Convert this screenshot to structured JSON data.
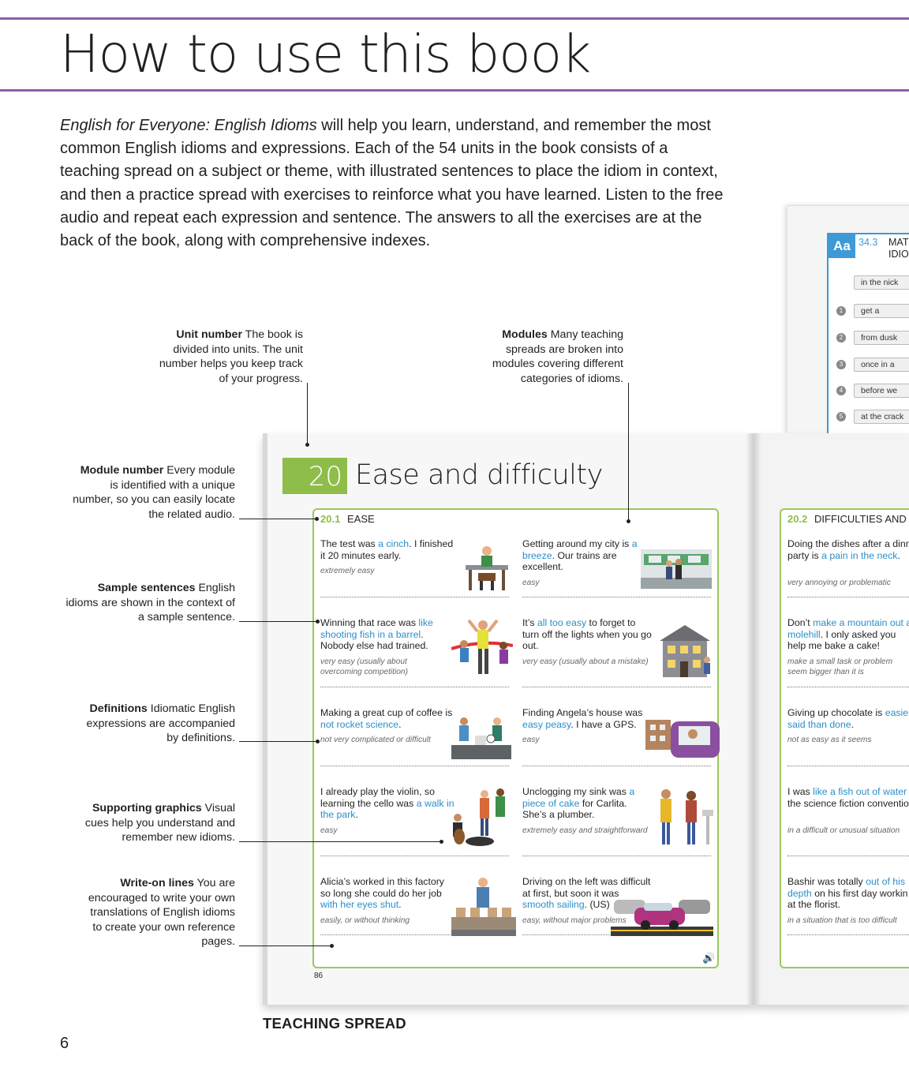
{
  "title": "How to use this book",
  "intro": {
    "book_title": "English for Everyone: English Idioms",
    "text": " will help you learn, understand, and remember the most common English idioms and expressions. Each of the 54 units in the book consists of a teaching spread on a subject or theme, with illustrated sentences to place the idiom in context, and then a practice spread with exercises to reinforce what you have learned. Listen to the free audio and repeat each expression and sentence. The answers to all the exercises are at the back of the book, along with comprehensive indexes."
  },
  "callouts": {
    "unit_number": {
      "head": "Unit number",
      "body": " The book is divided into units. The unit number helps you keep track of your progress."
    },
    "modules": {
      "head": "Modules",
      "body": " Many teaching spreads are broken into modules covering different categories of idioms."
    },
    "module_number": {
      "head": "Module number",
      "body": " Every module is identified with a unique number, so you can easily locate the related audio."
    },
    "sample_sentences": {
      "head": "Sample sentences",
      "body": " English idioms are shown in the context of a sample sentence."
    },
    "definitions": {
      "head": "Definitions",
      "body": " Idiomatic English expressions are accompanied by definitions."
    },
    "supporting_graphics": {
      "head": "Supporting graphics",
      "body": " Visual cues help you understand and remember new idioms."
    },
    "write_on_lines": {
      "head": "Write-on lines",
      "body": " You are encouraged to write your own translations of English idioms to create your own reference pages."
    }
  },
  "practice_page": {
    "badge": "Aa",
    "exercise_number": "34.3",
    "exercise_title_1": "MATC",
    "exercise_title_2": "IDIOMS TO",
    "example": "in the nick",
    "rows": [
      {
        "num": "1",
        "text": "get a"
      },
      {
        "num": "2",
        "text": "from dusk"
      },
      {
        "num": "3",
        "text": "once in a"
      },
      {
        "num": "4",
        "text": "before we"
      },
      {
        "num": "5",
        "text": "at the crack"
      }
    ]
  },
  "unit": {
    "number": "20",
    "title": "Ease and difficulty"
  },
  "module1": {
    "number": "20.1",
    "name": "EASE",
    "cells": [
      {
        "pre": "The test was ",
        "idiom": "a cinch",
        "post": ". I finished it 20 minutes early.",
        "def": "extremely easy"
      },
      {
        "pre": "Getting around my city is ",
        "idiom": "a breeze",
        "post": ". Our trains are excellent.",
        "def": "easy"
      },
      {
        "pre": "Winning that race was ",
        "idiom": "like shooting fish in a barrel",
        "post": ". Nobody else had trained.",
        "def": "very easy (usually about overcoming competition)"
      },
      {
        "pre": "It’s ",
        "idiom": "all too easy",
        "post": " to forget to turn off the lights when you go out.",
        "def": "very easy (usually about a mistake)"
      },
      {
        "pre": "Making a great cup of coffee is ",
        "idiom": "not rocket science",
        "post": ".",
        "def": "not very complicated or difficult"
      },
      {
        "pre": "Finding Angela’s house was ",
        "idiom": "easy peasy",
        "post": ". I have a GPS.",
        "def": "easy"
      },
      {
        "pre": "I already play the violin, so learning the cello was ",
        "idiom": "a walk in the park",
        "post": ".",
        "def": "easy"
      },
      {
        "pre": "Unclogging my sink was ",
        "idiom": "a piece of cake",
        "post": " for Carlita. She’s a plumber.",
        "def": "extremely easy and straightforward"
      },
      {
        "pre": "Alicia’s worked in this factory so long she could do her job ",
        "idiom": "with her eyes shut",
        "post": ".",
        "def": "easily, or without thinking"
      },
      {
        "pre": "Driving on the left was difficult at first, but soon it was ",
        "idiom": "smooth sailing",
        "post": ". (US)",
        "def": "easy, without major problems"
      }
    ]
  },
  "module2": {
    "number": "20.2",
    "name": "DIFFICULTIES AND PR",
    "cells": [
      {
        "pre": "Doing the dishes after a dinn party is ",
        "idiom": "a pain in the neck",
        "post": ".",
        "def": "very annoying or problematic"
      },
      {
        "pre": "Don’t ",
        "idiom": "make a mountain out a molehill",
        "post": ". I only asked you help me bake a cake!",
        "def": "make a small task or problem seem bigger than it is"
      },
      {
        "pre": "Giving up chocolate is ",
        "idiom": "easier said than done",
        "post": ".",
        "def": "not as easy as it seems"
      },
      {
        "pre": "I was ",
        "idiom": "like a fish out of water",
        "post": " the science fiction conventio",
        "def": "in a difficult or unusual situation"
      },
      {
        "pre": "Bashir was totally ",
        "idiom": "out of his depth",
        "post": " on his first day workin at the florist.",
        "def": "in a situation that is too difficult"
      }
    ]
  },
  "page_number": "86",
  "caption": "TEACHING SPREAD",
  "folio": "6",
  "colors": {
    "accent_purple": "#8e5ea6",
    "module_green": "#8fbd4a",
    "idiom_blue": "#2a8fc9",
    "exercise_blue": "#3d9ad6"
  }
}
